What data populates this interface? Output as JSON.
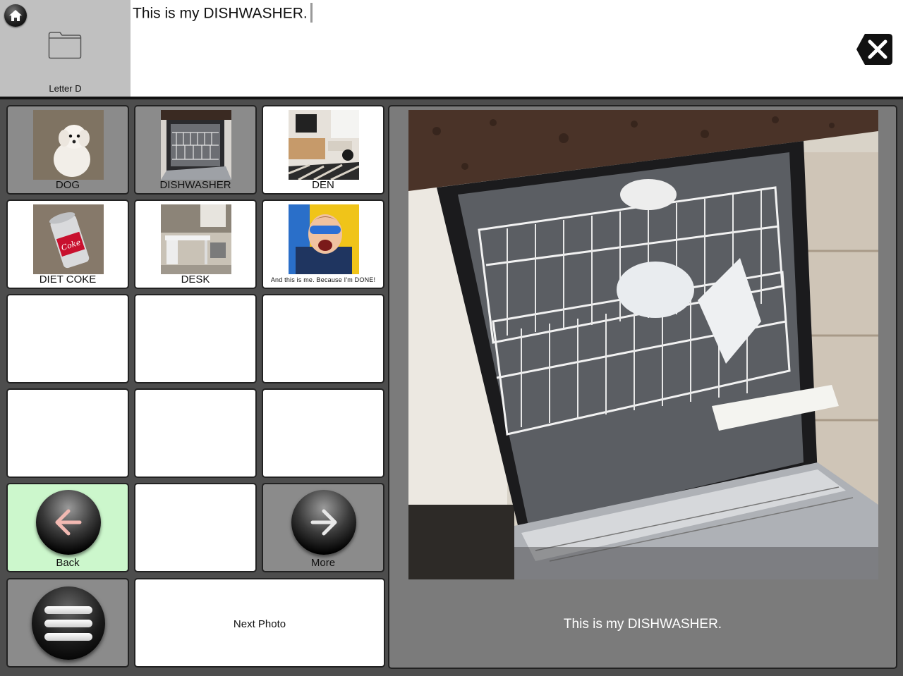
{
  "top": {
    "folder_label": "Letter D",
    "message": "This is my DISHWASHER.",
    "icons": {
      "home": "home-icon",
      "folder": "folder-icon",
      "clear": "clear-x-icon"
    }
  },
  "grid": {
    "dog": {
      "label": "DOG"
    },
    "dishwasher": {
      "label": "DISHWASHER"
    },
    "den": {
      "label": "DEN"
    },
    "diet_coke": {
      "label": "DIET COKE",
      "can_text": "Coke"
    },
    "desk": {
      "label": "DESK"
    },
    "me": {
      "label": "And this is me. Because I'm DONE!"
    },
    "back": {
      "label": "Back"
    },
    "more": {
      "label": "More"
    },
    "next_photo": {
      "label": "Next Photo"
    }
  },
  "photo_panel": {
    "caption": "This is my DISHWASHER."
  },
  "colors": {
    "back_cell": "#ccf7cc",
    "gray_cell": "#8b8b8b",
    "panel": "#7b7b7b",
    "background": "#4d4d4d"
  }
}
